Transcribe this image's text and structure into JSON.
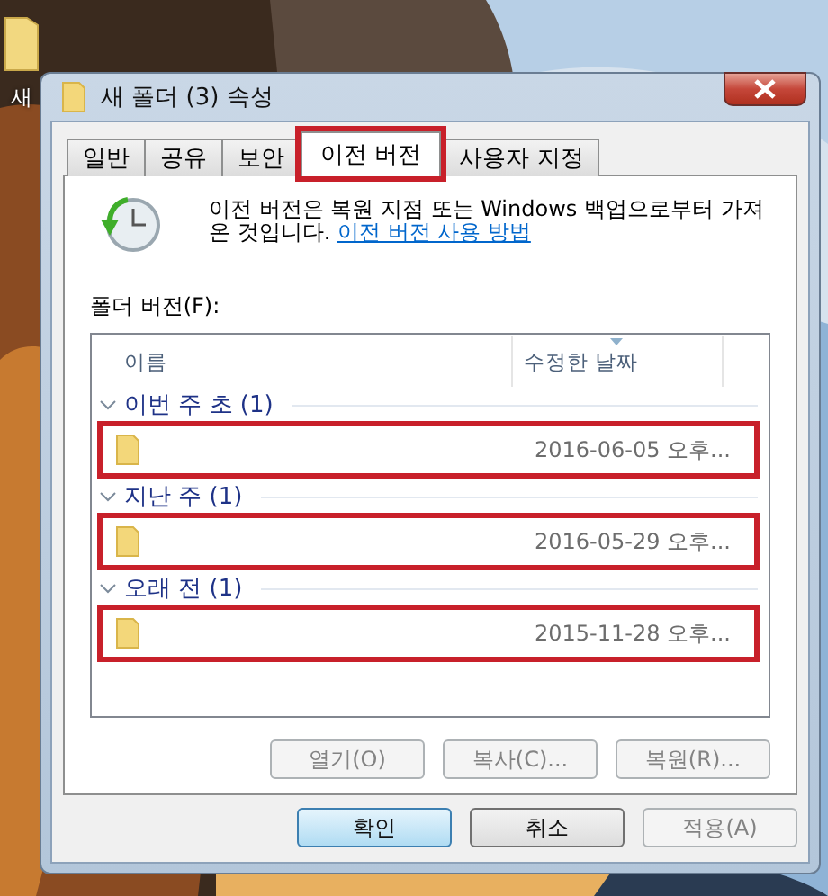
{
  "desktop": {
    "icon_label": "새"
  },
  "window": {
    "title": "새 폴더 (3) 속성"
  },
  "tabs": [
    {
      "label": "일반",
      "selected": false,
      "highlighted": false
    },
    {
      "label": "공유",
      "selected": false,
      "highlighted": false
    },
    {
      "label": "보안",
      "selected": false,
      "highlighted": false
    },
    {
      "label": "이전 버전",
      "selected": true,
      "highlighted": true
    },
    {
      "label": "사용자 지정",
      "selected": false,
      "highlighted": false
    }
  ],
  "info": {
    "text": "이전 버전은 복원 지점 또는 Windows 백업으로부터 가져온 것입니다.",
    "link": "이전 버전 사용 방법"
  },
  "list_label": "폴더 버전(F):",
  "columns": [
    "이름",
    "수정한 날짜"
  ],
  "groups": [
    {
      "name": "이번 주 초 (1)",
      "expanded": true,
      "items": [
        {
          "date": "2016-06-05 오후...",
          "highlighted": true
        }
      ]
    },
    {
      "name": "지난 주 (1)",
      "expanded": true,
      "items": [
        {
          "date": "2016-05-29 오후...",
          "highlighted": true
        }
      ]
    },
    {
      "name": "오래 전 (1)",
      "expanded": true,
      "items": [
        {
          "date": "2015-11-28 오후...",
          "highlighted": true
        }
      ]
    }
  ],
  "panel_buttons": [
    {
      "label": "열기(O)",
      "disabled": true
    },
    {
      "label": "복사(C)...",
      "disabled": true
    },
    {
      "label": "복원(R)...",
      "disabled": true
    }
  ],
  "dialog_buttons": [
    {
      "label": "확인",
      "disabled": false,
      "default": true
    },
    {
      "label": "취소",
      "disabled": false,
      "default": false
    },
    {
      "label": "적용(A)",
      "disabled": true,
      "default": false
    }
  ]
}
